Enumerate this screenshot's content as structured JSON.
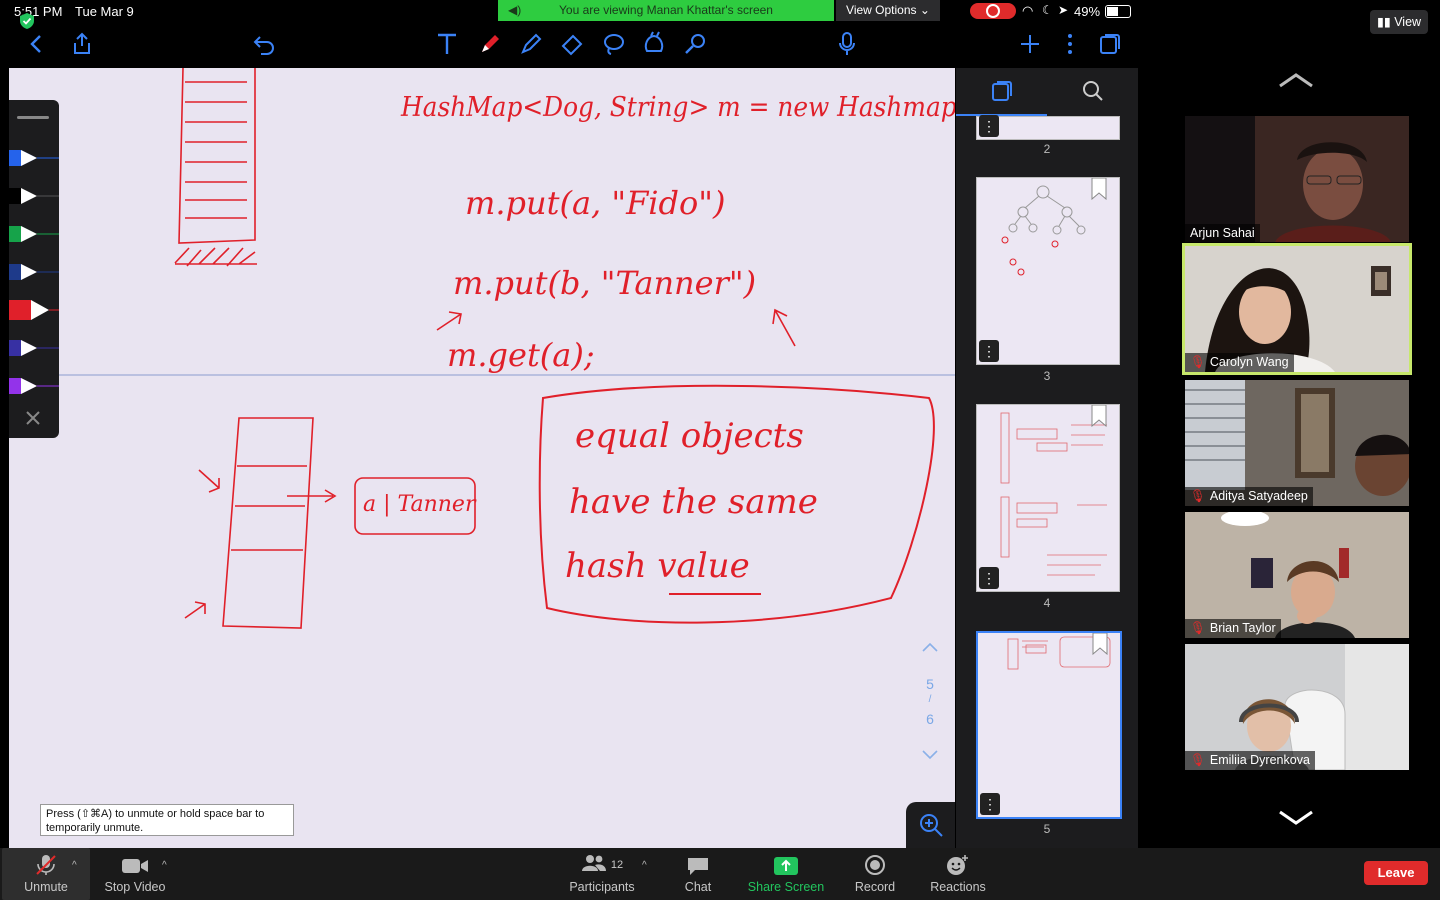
{
  "status": {
    "time": "5:51 PM",
    "date": "Tue Mar 9",
    "viewing_banner": "You are viewing Manan Khattar's screen",
    "view_options": "View Options",
    "battery": "49%"
  },
  "gallery": {
    "view_label": "View",
    "participants": [
      {
        "name": "Arjun Sahai",
        "muted": false
      },
      {
        "name": "Carolyn Wang",
        "muted": true
      },
      {
        "name": "Aditya Satyadeep",
        "muted": true
      },
      {
        "name": "Brian Taylor",
        "muted": true
      },
      {
        "name": "Emiliia Dyrenkova",
        "muted": true
      }
    ]
  },
  "thumbnails": {
    "pages": [
      "2",
      "3",
      "4",
      "5"
    ]
  },
  "page_indicator": {
    "current": "5",
    "total": "6"
  },
  "canvas": {
    "line1": "HashMap<Dog, String> m = new Hashmap<>();",
    "line2": "m.put(a, \"Fido\")",
    "line3": "m.put(b, \"Tanner\")",
    "line4": "m.get(a);",
    "bucket_label": "a | Tanner",
    "note1": "equal objects",
    "note2": "have the same",
    "note3": "hash value"
  },
  "tooltip": {
    "text": "Press (⇧⌘A) to unmute or hold space bar to temporarily unmute."
  },
  "bottom": {
    "unmute": "Unmute",
    "stop_video": "Stop Video",
    "participants": "Participants",
    "participants_count": "12",
    "chat": "Chat",
    "share_screen": "Share Screen",
    "record": "Record",
    "reactions": "Reactions",
    "leave": "Leave"
  },
  "colors": {
    "ink": "#e0202a",
    "share_green": "#22c55e",
    "active_speaker": "#c7e86b",
    "leave_red": "#e02b2b",
    "thumb_active": "#3b82f6"
  }
}
